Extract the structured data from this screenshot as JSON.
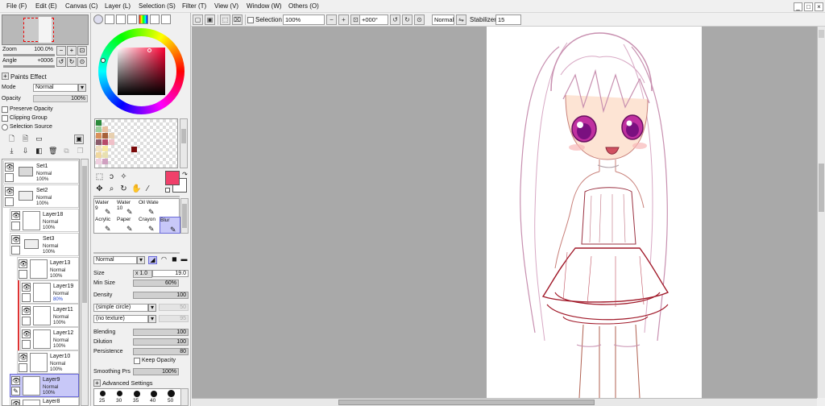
{
  "menubar": {
    "items": [
      "File (F)",
      "Edit (E)",
      "Canvas (C)",
      "Layer (L)",
      "Selection (S)",
      "Filter (T)",
      "View (V)",
      "Window (W)",
      "Others (O)"
    ],
    "window_buttons": [
      "_",
      "□",
      "×"
    ]
  },
  "toolbar": {
    "selection_label": "Selection",
    "zoom_value": "100%",
    "angle_value": "+000°",
    "blend_mode": "Normal",
    "stabilizer_label": "Stabilizer",
    "stabilizer_value": "15"
  },
  "navigator": {
    "zoom_label": "Zoom",
    "zoom_value": "100.0%",
    "angle_label": "Angle",
    "angle_value": "+0006"
  },
  "layer_props": {
    "paints_effect_label": "Paints Effect",
    "mode_label": "Mode",
    "mode_value": "Normal",
    "opacity_label": "Opacity",
    "opacity_value": "100%",
    "preserve_opacity_label": "Preserve Opacity",
    "clipping_group_label": "Clipping Group",
    "selection_source_label": "Selection Source"
  },
  "layers": [
    {
      "name": "Set1",
      "mode": "Normal",
      "opacity": "100%"
    },
    {
      "name": "Set2",
      "mode": "Normal",
      "opacity": "100%"
    },
    {
      "name": "Layer18",
      "mode": "Normal",
      "opacity": "100%"
    },
    {
      "name": "Set3",
      "mode": "Normal",
      "opacity": "100%"
    },
    {
      "name": "Layer13",
      "mode": "Normal",
      "opacity": "100%"
    },
    {
      "name": "Layer19",
      "mode": "Normal",
      "opacity": "80%"
    },
    {
      "name": "Layer11",
      "mode": "Normal",
      "opacity": "100%"
    },
    {
      "name": "Layer12",
      "mode": "Normal",
      "opacity": "100%"
    },
    {
      "name": "Layer10",
      "mode": "Normal",
      "opacity": "100%"
    },
    {
      "name": "Layer9",
      "mode": "Normal",
      "opacity": "100%"
    },
    {
      "name": "Layer8",
      "mode": "",
      "opacity": ""
    }
  ],
  "colors": {
    "primary": "#f0406a",
    "secondary": "#ffffff",
    "accent_select": "#c8c8f8"
  },
  "brushes": [
    {
      "name": "Water",
      "size": "9"
    },
    {
      "name": "Water",
      "size": "10"
    },
    {
      "name": "Oil Wate",
      "size": ""
    },
    {
      "name": "Acrylic",
      "size": ""
    },
    {
      "name": "Paper",
      "size": ""
    },
    {
      "name": "Crayon",
      "size": ""
    },
    {
      "name": "Blur",
      "size": ""
    }
  ],
  "brush_settings": {
    "mode_value": "Normal",
    "size_label": "Size",
    "size_mult": "x 1.0",
    "size_value": "19.0",
    "min_size_label": "Min Size",
    "min_size_value": "60%",
    "density_label": "Density",
    "density_value": "100",
    "shape_value": "(simple circle)",
    "shape_strength": "50",
    "texture_value": "(no texture)",
    "texture_strength": "95",
    "blending_label": "Blending",
    "blending_value": "100",
    "dilution_label": "Dilution",
    "dilution_value": "100",
    "persistence_label": "Persistence",
    "persistence_value": "80",
    "keep_opacity_label": "Keep Opacity",
    "smoothing_label": "Smoothing Prs",
    "smoothing_value": "100%",
    "advanced_label": "Advanced Settings",
    "dot_sizes": [
      "25",
      "30",
      "35",
      "40",
      "50"
    ]
  }
}
